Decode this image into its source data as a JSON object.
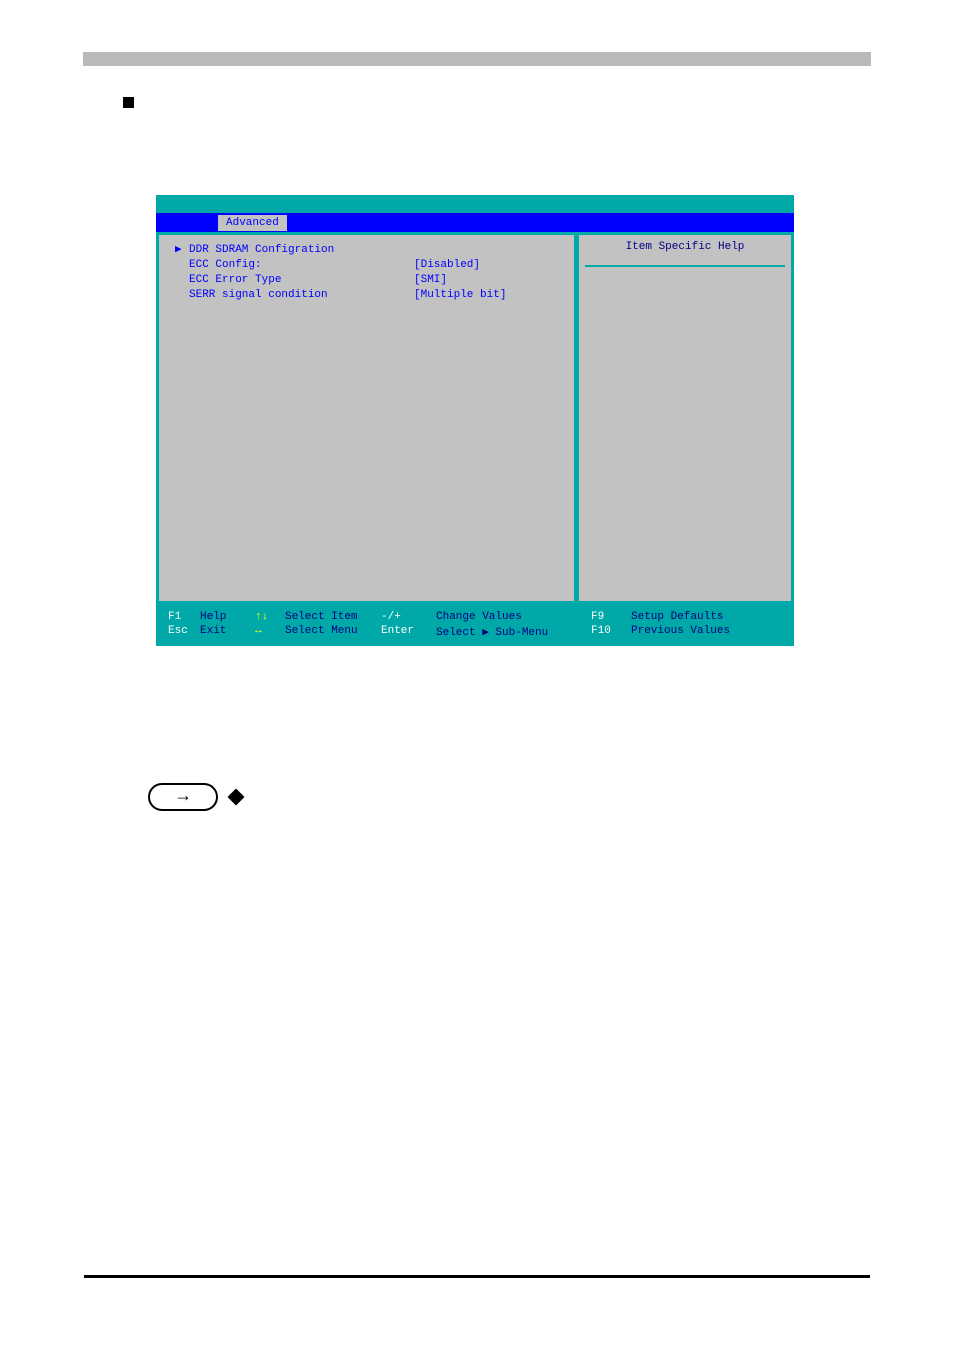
{
  "tabs": {
    "advanced": "Advanced"
  },
  "help": {
    "title": "Item Specific Help"
  },
  "menu": {
    "item0_marker": "▶",
    "item0_label": "DDR SDRAM Configration",
    "item1_label": "ECC Config:",
    "item1_value": "[Disabled]",
    "item2_label": "ECC Error Type",
    "item2_value": "[SMI]",
    "item3_label": "SERR signal condition",
    "item3_value": "[Multiple bit]"
  },
  "footer": {
    "f1": "F1",
    "help": "Help",
    "updown": "↑↓",
    "select_item": "Select Item",
    "minusplus": "-/+",
    "change_values": "Change Values",
    "f9": "F9",
    "setup_defaults": "Setup Defaults",
    "esc": "Esc",
    "exit": "Exit",
    "leftright": "↔",
    "select_menu": "Select Menu",
    "enter": "Enter",
    "select_sub": "Select ▶ Sub-Menu",
    "f10": "F10",
    "previous_values": "Previous Values"
  },
  "note_arrow": "→"
}
